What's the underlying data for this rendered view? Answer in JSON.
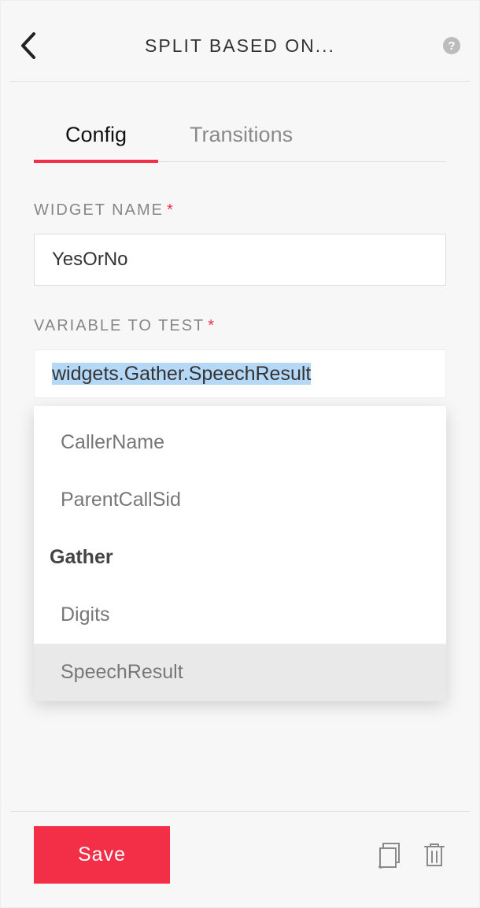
{
  "header": {
    "title": "SPLIT BASED ON..."
  },
  "tabs": {
    "config": "Config",
    "transitions": "Transitions",
    "active": "config"
  },
  "form": {
    "widget_name_label": "WIDGET NAME",
    "widget_name_value": "YesOrNo",
    "variable_label": "VARIABLE TO TEST",
    "variable_value": "widgets.Gather.SpeechResult"
  },
  "dropdown": {
    "items": [
      {
        "type": "item",
        "label": "CallerName"
      },
      {
        "type": "item",
        "label": "ParentCallSid"
      },
      {
        "type": "group",
        "label": "Gather"
      },
      {
        "type": "item",
        "label": "Digits"
      },
      {
        "type": "item",
        "label": "SpeechResult",
        "selected": true
      }
    ]
  },
  "footer": {
    "save_label": "Save"
  }
}
